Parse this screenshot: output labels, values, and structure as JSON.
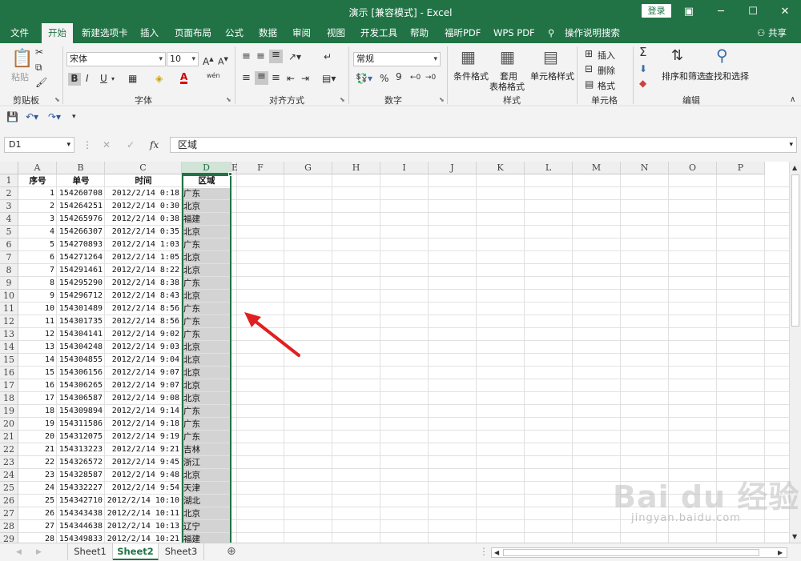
{
  "window": {
    "title": "演示 [兼容模式] - Excel",
    "login": "登录",
    "minimize": "─",
    "restore": "☐",
    "maximize": "☐",
    "close": "✕"
  },
  "menu": {
    "tabs": [
      "文件",
      "开始",
      "新建选项卡",
      "插入",
      "页面布局",
      "公式",
      "数据",
      "审阅",
      "视图",
      "开发工具",
      "帮助",
      "福昕PDF",
      "WPS PDF",
      "操作说明搜索"
    ],
    "active": "开始",
    "share": "共享"
  },
  "ribbon": {
    "clipboard": {
      "label": "剪贴板",
      "paste": "粘贴"
    },
    "font": {
      "label": "字体",
      "name": "宋体",
      "size": "10",
      "bold": "B",
      "italic": "I",
      "underline": "U",
      "increase": "A",
      "decrease": "A",
      "color_a": "A",
      "wen": "wén"
    },
    "align": {
      "label": "对齐方式"
    },
    "number": {
      "label": "数字",
      "format": "常规",
      "percent": "%",
      "comma": "9"
    },
    "styles": {
      "label": "样式",
      "cond": "条件格式",
      "table1": "套用",
      "table2": "表格格式",
      "cell": "单元格样式"
    },
    "cells": {
      "label": "单元格",
      "insert": "插入",
      "delete": "删除",
      "format": "格式"
    },
    "edit": {
      "label": "编辑",
      "sort": "排序和筛选",
      "find": "查找和选择",
      "sigma": "Σ"
    }
  },
  "formula": {
    "namebox": "D1",
    "fx": "fx",
    "value": "区域"
  },
  "columns": [
    "A",
    "B",
    "C",
    "D",
    "E",
    "F",
    "G",
    "H",
    "I",
    "J",
    "K",
    "L",
    "M",
    "N",
    "O",
    "P"
  ],
  "header": [
    "序号",
    "单号",
    "时间",
    "区域"
  ],
  "rows": [
    [
      "1",
      "154260708",
      "2012/2/14 0:18",
      "广东"
    ],
    [
      "2",
      "154264251",
      "2012/2/14 0:30",
      "北京"
    ],
    [
      "3",
      "154265976",
      "2012/2/14 0:38",
      "福建"
    ],
    [
      "4",
      "154266307",
      "2012/2/14 0:35",
      "北京"
    ],
    [
      "5",
      "154270893",
      "2012/2/14 1:03",
      "广东"
    ],
    [
      "6",
      "154271264",
      "2012/2/14 1:05",
      "北京"
    ],
    [
      "7",
      "154291461",
      "2012/2/14 8:22",
      "北京"
    ],
    [
      "8",
      "154295290",
      "2012/2/14 8:38",
      "广东"
    ],
    [
      "9",
      "154296712",
      "2012/2/14 8:43",
      "北京"
    ],
    [
      "10",
      "154301489",
      "2012/2/14 8:56",
      "广东"
    ],
    [
      "11",
      "154301735",
      "2012/2/14 8:56",
      "广东"
    ],
    [
      "12",
      "154304141",
      "2012/2/14 9:02",
      "广东"
    ],
    [
      "13",
      "154304248",
      "2012/2/14 9:03",
      "北京"
    ],
    [
      "14",
      "154304855",
      "2012/2/14 9:04",
      "北京"
    ],
    [
      "15",
      "154306156",
      "2012/2/14 9:07",
      "北京"
    ],
    [
      "16",
      "154306265",
      "2012/2/14 9:07",
      "北京"
    ],
    [
      "17",
      "154306587",
      "2012/2/14 9:08",
      "北京"
    ],
    [
      "18",
      "154309894",
      "2012/2/14 9:14",
      "广东"
    ],
    [
      "19",
      "154311586",
      "2012/2/14 9:18",
      "广东"
    ],
    [
      "20",
      "154312075",
      "2012/2/14 9:19",
      "广东"
    ],
    [
      "21",
      "154313223",
      "2012/2/14 9:21",
      "吉林"
    ],
    [
      "22",
      "154326572",
      "2012/2/14 9:45",
      "浙江"
    ],
    [
      "23",
      "154328587",
      "2012/2/14 9:48",
      "北京"
    ],
    [
      "24",
      "154332227",
      "2012/2/14 9:54",
      "天津"
    ],
    [
      "25",
      "154342710",
      "2012/2/14 10:10",
      "湖北"
    ],
    [
      "26",
      "154343438",
      "2012/2/14 10:11",
      "北京"
    ],
    [
      "27",
      "154344638",
      "2012/2/14 10:13",
      "辽宁"
    ],
    [
      "28",
      "154349833",
      "2012/2/14 10:21",
      "福建"
    ]
  ],
  "sheets": [
    "Sheet1",
    "Sheet2",
    "Sheet3"
  ],
  "active_sheet": "Sheet2",
  "watermark": {
    "main": "Bai du 经验",
    "sub": "jingyan.baidu.com"
  },
  "colors": {
    "accent": "#217346",
    "arrow": "#e02020"
  }
}
